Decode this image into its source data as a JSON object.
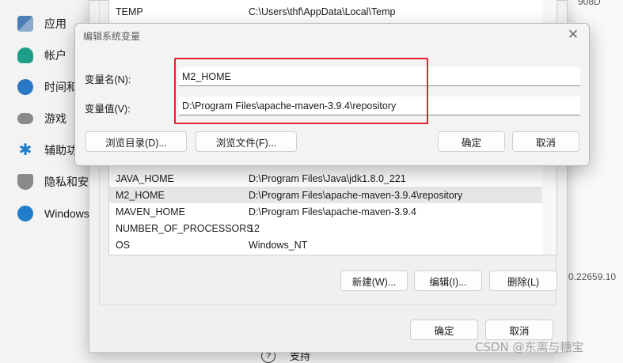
{
  "sidebar": {
    "items": [
      {
        "label": "应用",
        "icon": "apps-icon",
        "color": "#3a6ea5"
      },
      {
        "label": "帐户",
        "icon": "account-icon",
        "color": "#1e9e8a"
      },
      {
        "label": "时间和",
        "icon": "clock-globe-icon",
        "color": "#2a78c5"
      },
      {
        "label": "游戏",
        "icon": "gamepad-icon",
        "color": "#7a7a7a"
      },
      {
        "label": "辅助功",
        "icon": "accessibility-icon",
        "color": "#1f7ecb"
      },
      {
        "label": "隐私和安",
        "icon": "shield-icon",
        "color": "#8a8a8a"
      },
      {
        "label": "Windows",
        "icon": "windows-update-icon",
        "color": "#1f7ecb"
      }
    ]
  },
  "right_fragments": {
    "top": "908D",
    "middle": "0.22659.10"
  },
  "support": {
    "label": "支持",
    "icon": "question-icon"
  },
  "env_dialog": {
    "top_row": {
      "name": "TEMP",
      "value": "C:\\Users\\thf\\AppData\\Local\\Temp"
    },
    "rows": [
      {
        "name": "JAVA_HOME",
        "value": "D:\\Program Files\\Java\\jdk1.8.0_221",
        "selected": false
      },
      {
        "name": "M2_HOME",
        "value": "D:\\Program Files\\apache-maven-3.9.4\\repository",
        "selected": true
      },
      {
        "name": "MAVEN_HOME",
        "value": "D:\\Program Files\\apache-maven-3.9.4",
        "selected": false
      },
      {
        "name": "NUMBER_OF_PROCESSORS",
        "value": "12",
        "selected": false
      },
      {
        "name": "OS",
        "value": "Windows_NT",
        "selected": false
      }
    ],
    "buttons": {
      "new": "新建(W)...",
      "edit": "编辑(I)...",
      "delete": "删除(L)",
      "ok": "确定",
      "cancel": "取消"
    }
  },
  "edit_dialog": {
    "title": "编辑系统变量",
    "close": "✕",
    "name_label": "变量名(N):",
    "name_value": "M2_HOME",
    "value_label": "变量值(V):",
    "value_value": "D:\\Program Files\\apache-maven-3.9.4\\repository",
    "buttons": {
      "browse_dir": "浏览目录(D)...",
      "browse_file": "浏览文件(F)...",
      "ok": "确定",
      "cancel": "取消"
    },
    "highlight_color": "#e0232e"
  },
  "watermark": "CSDN @东离与糖宝"
}
